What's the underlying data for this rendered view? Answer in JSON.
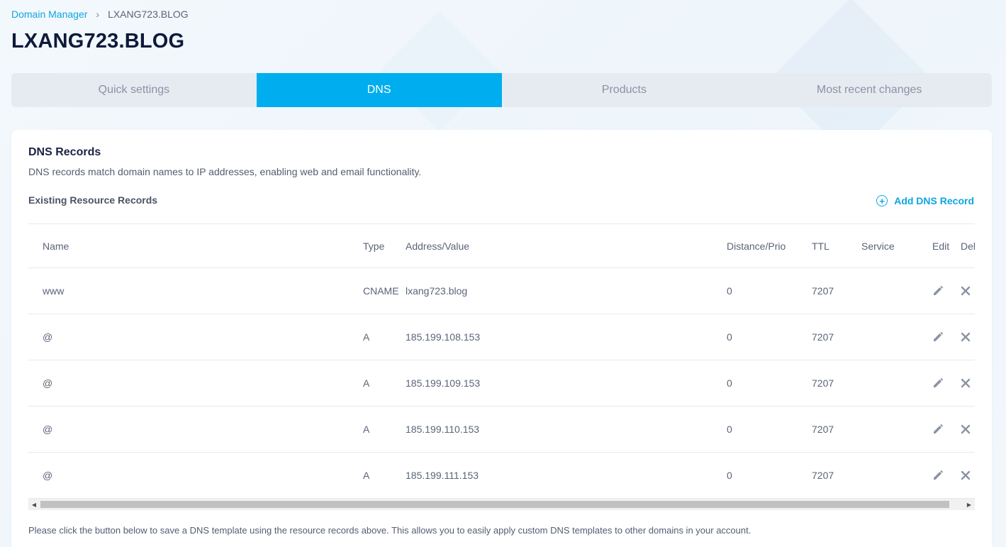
{
  "breadcrumb": {
    "parent": "Domain Manager",
    "separator": "›",
    "current": "LXANG723.BLOG"
  },
  "page_title": "LXANG723.BLOG",
  "tabs": [
    {
      "label": "Quick settings",
      "active": false
    },
    {
      "label": "DNS",
      "active": true
    },
    {
      "label": "Products",
      "active": false
    },
    {
      "label": "Most recent changes",
      "active": false
    }
  ],
  "dns": {
    "title": "DNS Records",
    "description": "DNS records match domain names to IP addresses, enabling web and email functionality.",
    "existing_label": "Existing Resource Records",
    "add_button": "Add DNS Record",
    "columns": {
      "name": "Name",
      "type": "Type",
      "address": "Address/Value",
      "prio": "Distance/Prio",
      "ttl": "TTL",
      "service": "Service",
      "edit": "Edit",
      "delete": "Del"
    },
    "records": [
      {
        "name": "www",
        "type": "CNAME",
        "address": "lxang723.blog",
        "prio": "0",
        "ttl": "7207",
        "service": ""
      },
      {
        "name": "@",
        "type": "A",
        "address": "185.199.108.153",
        "prio": "0",
        "ttl": "7207",
        "service": ""
      },
      {
        "name": "@",
        "type": "A",
        "address": "185.199.109.153",
        "prio": "0",
        "ttl": "7207",
        "service": ""
      },
      {
        "name": "@",
        "type": "A",
        "address": "185.199.110.153",
        "prio": "0",
        "ttl": "7207",
        "service": ""
      },
      {
        "name": "@",
        "type": "A",
        "address": "185.199.111.153",
        "prio": "0",
        "ttl": "7207",
        "service": ""
      }
    ],
    "footer_note": "Please click the button below to save a DNS template using the resource records above. This allows you to easily apply custom DNS templates to other domains in your account."
  },
  "colors": {
    "accent": "#00aeef",
    "link": "#0ea5e0",
    "title": "#0d1a3a"
  }
}
